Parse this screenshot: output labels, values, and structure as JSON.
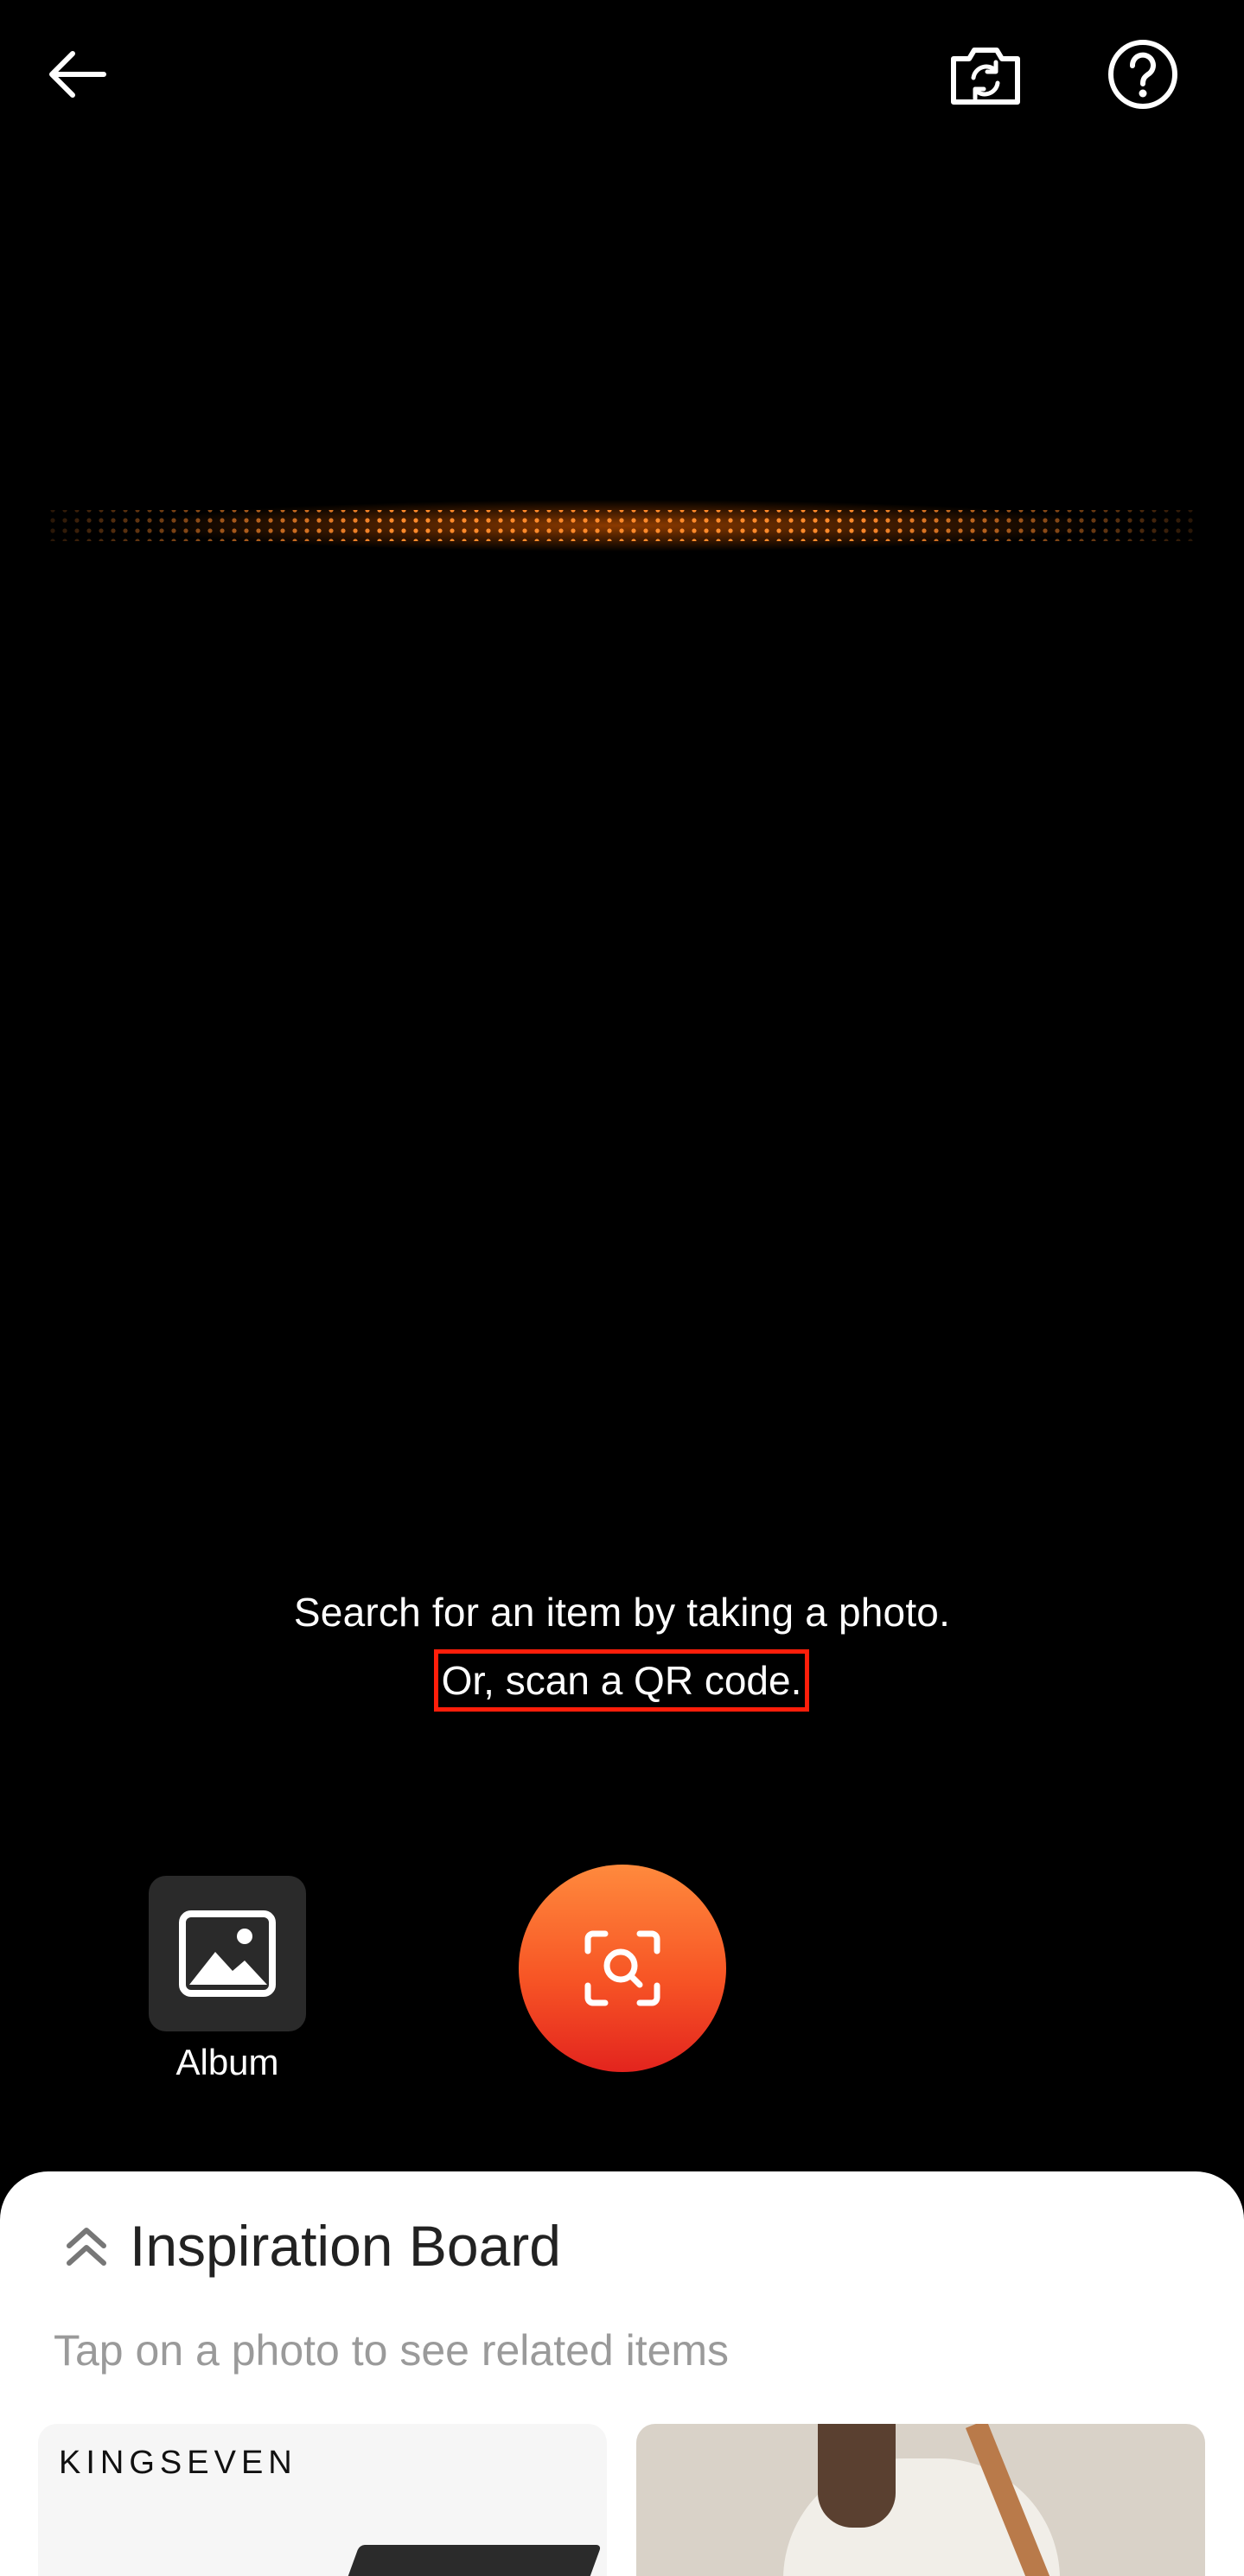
{
  "topbar": {
    "back_icon": "arrow-left-icon",
    "flip_icon": "camera-flip-icon",
    "help_icon": "help-circle-icon"
  },
  "camera": {
    "hint_line1": "Search for an item by taking a photo.",
    "hint_line2": "Or, scan a QR code."
  },
  "controls": {
    "album_label": "Album",
    "album_icon": "image-icon",
    "shutter_icon": "visual-search-icon"
  },
  "inspiration": {
    "expand_icon": "chevron-up-double-icon",
    "title": "Inspiration Board",
    "subtitle": "Tap on a photo to see related items",
    "cards": [
      {
        "brand": "KINGSEVEN"
      },
      {
        "brand": ""
      }
    ]
  },
  "colors": {
    "accent_start": "#ff8a3d",
    "accent_end": "#e3241e",
    "highlight_border": "#ff1e0a"
  }
}
